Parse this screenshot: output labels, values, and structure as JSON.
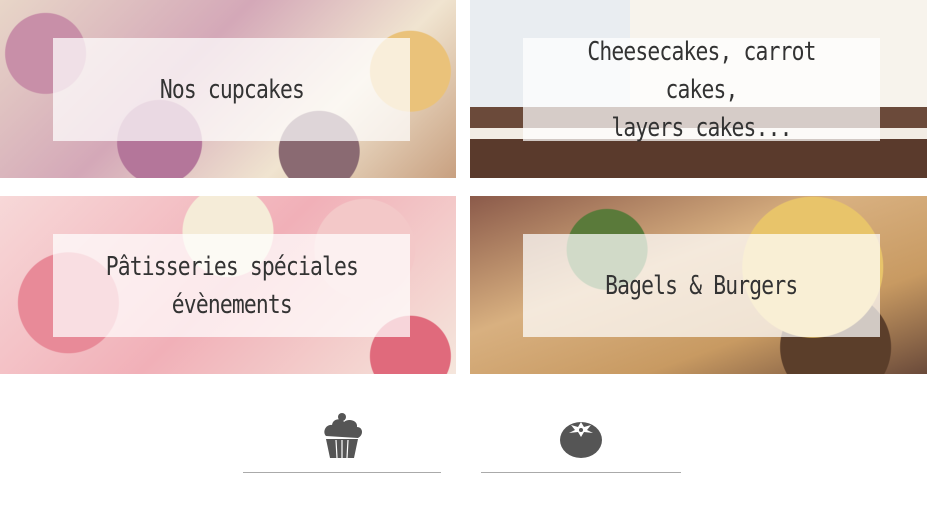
{
  "tiles": [
    {
      "id": "cupcakes",
      "label": "Nos cupcakes"
    },
    {
      "id": "cheesecakes",
      "label": "Cheesecakes, carrot cakes,\nlayers cakes..."
    },
    {
      "id": "evenements",
      "label": "Pâtisseries spéciales\névènements"
    },
    {
      "id": "bagels",
      "label": "Bagels & Burgers"
    }
  ],
  "icons": [
    {
      "name": "cupcake-icon",
      "color": "#555555"
    },
    {
      "name": "tomato-icon",
      "color": "#555555"
    }
  ],
  "colors": {
    "overlay": "rgba(255,255,255,0.72)",
    "text": "#333333",
    "rule": "#aaaaaa"
  }
}
